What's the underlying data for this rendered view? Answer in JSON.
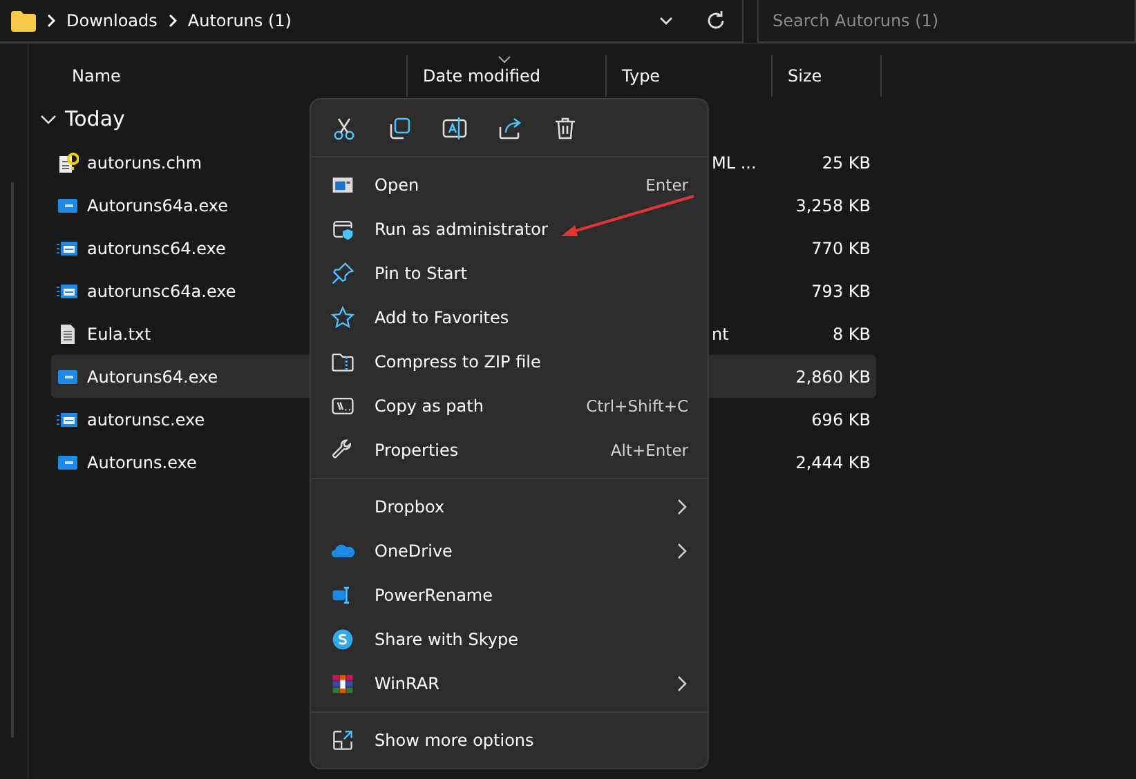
{
  "address_bar": {
    "crumbs": [
      "Downloads",
      "Autoruns (1)"
    ]
  },
  "search": {
    "placeholder": "Search Autoruns (1)"
  },
  "columns": [
    "Name",
    "Date modified",
    "Type",
    "Size"
  ],
  "group": {
    "label": "Today",
    "expanded": true
  },
  "files": [
    {
      "name": "autoruns.chm",
      "kind": "help",
      "type": "ML ...",
      "size": "25 KB",
      "selected": false
    },
    {
      "name": "Autoruns64a.exe",
      "kind": "app",
      "size": "3,258 KB",
      "selected": false
    },
    {
      "name": "autorunsc64.exe",
      "kind": "console",
      "size": "770 KB",
      "selected": false
    },
    {
      "name": "autorunsc64a.exe",
      "kind": "console",
      "size": "793 KB",
      "selected": false
    },
    {
      "name": "Eula.txt",
      "kind": "text",
      "type": "nt",
      "size": "8 KB",
      "selected": false
    },
    {
      "name": "Autoruns64.exe",
      "kind": "app",
      "size": "2,860 KB",
      "selected": true
    },
    {
      "name": "autorunsc.exe",
      "kind": "console",
      "size": "696 KB",
      "selected": false
    },
    {
      "name": "Autoruns.exe",
      "kind": "app",
      "size": "2,444 KB",
      "selected": false
    }
  ],
  "context_menu": {
    "main_items": [
      {
        "label": "Open",
        "shortcut": "Enter"
      },
      {
        "label": "Run as administrator"
      },
      {
        "label": "Pin to Start"
      },
      {
        "label": "Add to Favorites"
      },
      {
        "label": "Compress to ZIP file"
      },
      {
        "label": "Copy as path",
        "shortcut": "Ctrl+Shift+C"
      },
      {
        "label": "Properties",
        "shortcut": "Alt+Enter"
      }
    ],
    "app_items": [
      {
        "label": "Dropbox",
        "submenu": true
      },
      {
        "label": "OneDrive",
        "submenu": true
      },
      {
        "label": "PowerRename",
        "submenu": false
      },
      {
        "label": "Share with Skype",
        "submenu": false
      },
      {
        "label": "WinRAR",
        "submenu": true
      }
    ],
    "footer_item": {
      "label": "Show more options"
    }
  }
}
